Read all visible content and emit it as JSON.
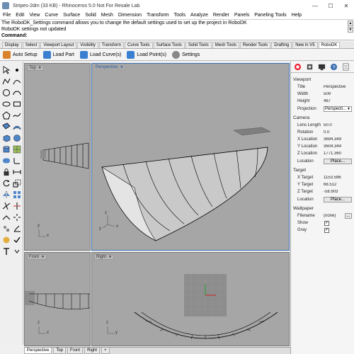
{
  "window": {
    "title": "Stripes-2dm (33 KB) - Rhinoceros 5.0 Not For Resale Lab",
    "minimize": "—",
    "maximize": "☐",
    "close": "✕"
  },
  "menu": [
    "File",
    "Edit",
    "View",
    "Curve",
    "Surface",
    "Solid",
    "Mesh",
    "Dimension",
    "Transform",
    "Tools",
    "Analyze",
    "Render",
    "Panels",
    "Paneling Tools",
    "Help"
  ],
  "command": {
    "history_1": "The RoboDK_Settings command allows you to change the default settings used to set up the project in RoboDK",
    "history_2": "RoboDK settings not updated",
    "prompt": "Command:"
  },
  "tabs": [
    "Display",
    "Select",
    "Viewport Layout",
    "Visibility",
    "Transform",
    "Curve Tools",
    "Surface Tools",
    "Solid Tools",
    "Mesh Tools",
    "Render Tools",
    "Drafting",
    "New in V5",
    "RoboDK"
  ],
  "toolbar": {
    "load_setup": "Auto Setup",
    "load_part": "Load Part",
    "load_curves": "Load Curve(s)",
    "load_points": "Load Point(s)",
    "settings": "Settings"
  },
  "viewports": {
    "top": "Top",
    "perspective": "Perspective",
    "front": "Front",
    "right": "Right"
  },
  "viewport_tabs": [
    "Perspective",
    "Top",
    "Front",
    "Right",
    "+"
  ],
  "properties": {
    "viewport_header": "Viewport",
    "title_label": "Title",
    "title_value": "Perspective",
    "width_label": "Width",
    "width_value": "509",
    "height_label": "Height",
    "height_value": "487",
    "projection_label": "Projection",
    "projection_value": "Perspecti...",
    "camera_header": "Camera",
    "lens_label": "Lens Length",
    "lens_value": "50.0",
    "rotation_label": "Rotation",
    "rotation_value": "0.0",
    "xloc_label": "X Location",
    "xloc_value": "3694.349",
    "yloc_label": "Y Location",
    "yloc_value": "3604.344",
    "zloc_label": "Z Location",
    "zloc_value": "1771.360",
    "location_label": "Location",
    "location_button": "Place...",
    "target_header": "Target",
    "xt_label": "X Target",
    "xt_value": "1153.596",
    "yt_label": "Y Target",
    "yt_value": "68.512",
    "zt_label": "Z Target",
    "zt_value": "-58.903",
    "tlocation_label": "Location",
    "tlocation_button": "Place...",
    "wallpaper_header": "Wallpaper",
    "filename_label": "Filename",
    "filename_value": "(none)",
    "show_label": "Show",
    "gray_label": "Gray",
    "check": "✓",
    "more": "..."
  },
  "axes": {
    "x": "x",
    "y": "y",
    "z": "z"
  },
  "colors": {
    "viewport_bg": "#a6a6a6",
    "active_border": "#3b6fb0",
    "accent": "#2a5fa5"
  }
}
